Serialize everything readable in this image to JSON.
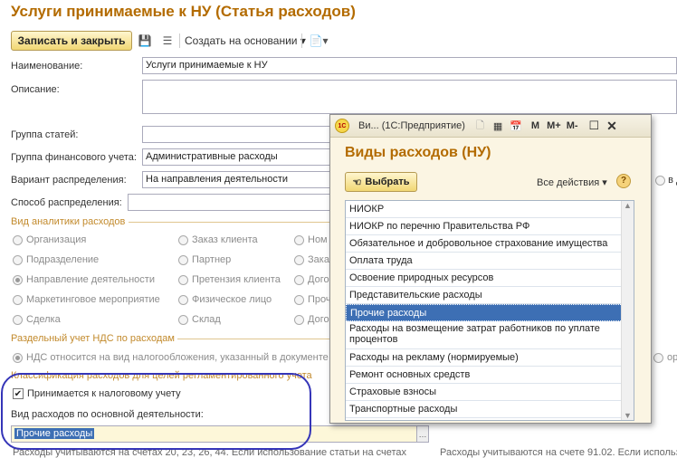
{
  "window": {
    "title": "Услуги принимаемые к НУ (Статья расходов)"
  },
  "toolbar": {
    "save_close": "Записать и закрыть",
    "create_basis": "Создать на основании"
  },
  "form": {
    "name_label": "Наименование:",
    "name_value": "Услуги принимаемые к НУ",
    "description_label": "Описание:",
    "group_label": "Группа статей:",
    "fin_group_label": "Группа финансового учета:",
    "fin_group_value": "Административные расходы",
    "dist_variant_label": "Вариант распределения:",
    "dist_variant_value": "На направления деятельности",
    "dist_variant_tail": "в до",
    "dist_method_label": "Способ распределения:",
    "analytics_group": "Вид аналитики расходов",
    "radios": [
      [
        "Организация",
        "Заказ клиента",
        "Ном"
      ],
      [
        "Подразделение",
        "Партнер",
        "Зака"
      ],
      [
        "Направление деятельности",
        "Претензия клиента",
        "Дого"
      ],
      [
        "Маркетинговое мероприятие",
        "Физическое лицо",
        "Прочи"
      ],
      [
        "Сделка",
        "Склад",
        "Дого"
      ]
    ],
    "vat_group": "Раздельный учет НДС по расходам",
    "vat_option": "НДС относится на вид налогообложения, указанный в документе",
    "vat_tail": "орци",
    "classification_group": "Классификация расходов для целей регламентированного учета",
    "tax_checkbox": "Принимается к налоговому учету",
    "expense_kind_label": "Вид расходов по основной деятельности:",
    "expense_kind_value": "Прочие расходы",
    "bottom_left": "Расходы учитываются на счетах 20, 23, 26, 44. Если использование статьи на счетах",
    "bottom_right": "Расходы учитываются на счете 91.02. Если использ"
  },
  "popup": {
    "window_title": "Ви... (1С:Предприятие)",
    "tb_m": "M",
    "tb_mplus": "M+",
    "tb_mminus": "M-",
    "heading": "Виды расходов (НУ)",
    "select_button": "Выбрать",
    "all_actions": "Все действия",
    "help": "?",
    "items": [
      "НИОКР",
      "НИОКР по перечню Правительства РФ",
      "Обязательное и добровольное страхование имущества",
      "Оплата труда",
      "Освоение природных ресурсов",
      "Представительские расходы",
      "Прочие расходы",
      "Расходы на возмещение затрат работников по уплате процентов",
      "Расходы на рекламу (нормируемые)",
      "Ремонт основных средств",
      "Страховые взносы",
      "Транспортные расходы"
    ],
    "selected_index": 6
  },
  "colors": {
    "title": "#b36b00",
    "group": "#c28a2c",
    "selection": "#3d6fb4",
    "highlight": "#3535b8"
  }
}
